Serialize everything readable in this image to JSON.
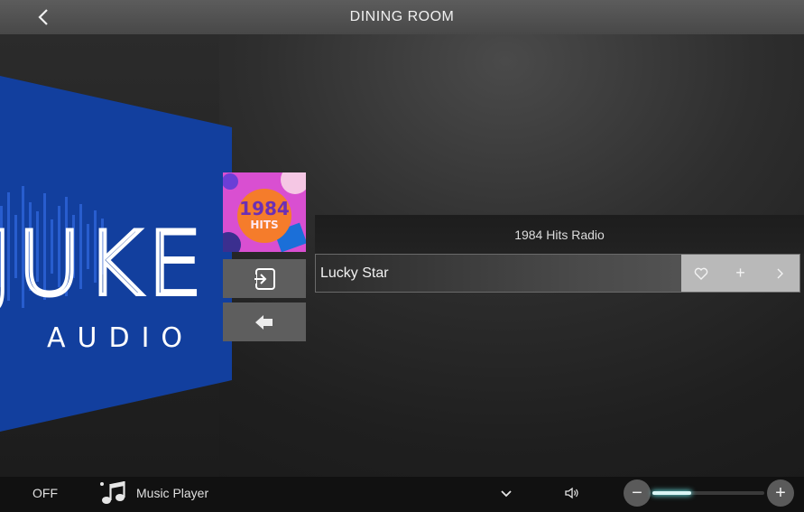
{
  "header": {
    "title": "DINING ROOM"
  },
  "logo": {
    "word1": "JUKE",
    "word2": "AUDIO"
  },
  "album_art": {
    "line1": "1984",
    "line2": "HITS"
  },
  "now_playing": {
    "station": "1984 Hits Radio",
    "track": "Lucky Star"
  },
  "track_actions": [
    "heart-icon",
    "plus-icon",
    "chevron-right-icon"
  ],
  "bottom": {
    "power_label": "OFF",
    "source_label": "Music Player",
    "volume_level": 0.35
  },
  "colors": {
    "logo_blue": "#123f9e",
    "slider_glow": "#5fd0d0",
    "art_magenta": "#d94fd1",
    "art_orange": "#f57c2b"
  }
}
